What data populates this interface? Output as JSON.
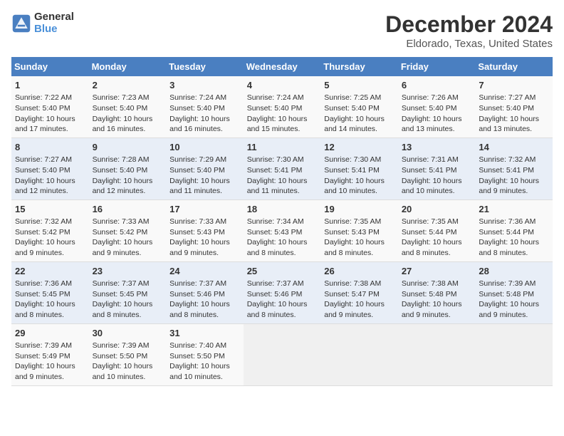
{
  "logo": {
    "line1": "General",
    "line2": "Blue"
  },
  "title": "December 2024",
  "subtitle": "Eldorado, Texas, United States",
  "days_of_week": [
    "Sunday",
    "Monday",
    "Tuesday",
    "Wednesday",
    "Thursday",
    "Friday",
    "Saturday"
  ],
  "weeks": [
    [
      {
        "day": "1",
        "info": "Sunrise: 7:22 AM\nSunset: 5:40 PM\nDaylight: 10 hours\nand 17 minutes."
      },
      {
        "day": "2",
        "info": "Sunrise: 7:23 AM\nSunset: 5:40 PM\nDaylight: 10 hours\nand 16 minutes."
      },
      {
        "day": "3",
        "info": "Sunrise: 7:24 AM\nSunset: 5:40 PM\nDaylight: 10 hours\nand 16 minutes."
      },
      {
        "day": "4",
        "info": "Sunrise: 7:24 AM\nSunset: 5:40 PM\nDaylight: 10 hours\nand 15 minutes."
      },
      {
        "day": "5",
        "info": "Sunrise: 7:25 AM\nSunset: 5:40 PM\nDaylight: 10 hours\nand 14 minutes."
      },
      {
        "day": "6",
        "info": "Sunrise: 7:26 AM\nSunset: 5:40 PM\nDaylight: 10 hours\nand 13 minutes."
      },
      {
        "day": "7",
        "info": "Sunrise: 7:27 AM\nSunset: 5:40 PM\nDaylight: 10 hours\nand 13 minutes."
      }
    ],
    [
      {
        "day": "8",
        "info": "Sunrise: 7:27 AM\nSunset: 5:40 PM\nDaylight: 10 hours\nand 12 minutes."
      },
      {
        "day": "9",
        "info": "Sunrise: 7:28 AM\nSunset: 5:40 PM\nDaylight: 10 hours\nand 12 minutes."
      },
      {
        "day": "10",
        "info": "Sunrise: 7:29 AM\nSunset: 5:40 PM\nDaylight: 10 hours\nand 11 minutes."
      },
      {
        "day": "11",
        "info": "Sunrise: 7:30 AM\nSunset: 5:41 PM\nDaylight: 10 hours\nand 11 minutes."
      },
      {
        "day": "12",
        "info": "Sunrise: 7:30 AM\nSunset: 5:41 PM\nDaylight: 10 hours\nand 10 minutes."
      },
      {
        "day": "13",
        "info": "Sunrise: 7:31 AM\nSunset: 5:41 PM\nDaylight: 10 hours\nand 10 minutes."
      },
      {
        "day": "14",
        "info": "Sunrise: 7:32 AM\nSunset: 5:41 PM\nDaylight: 10 hours\nand 9 minutes."
      }
    ],
    [
      {
        "day": "15",
        "info": "Sunrise: 7:32 AM\nSunset: 5:42 PM\nDaylight: 10 hours\nand 9 minutes."
      },
      {
        "day": "16",
        "info": "Sunrise: 7:33 AM\nSunset: 5:42 PM\nDaylight: 10 hours\nand 9 minutes."
      },
      {
        "day": "17",
        "info": "Sunrise: 7:33 AM\nSunset: 5:43 PM\nDaylight: 10 hours\nand 9 minutes."
      },
      {
        "day": "18",
        "info": "Sunrise: 7:34 AM\nSunset: 5:43 PM\nDaylight: 10 hours\nand 8 minutes."
      },
      {
        "day": "19",
        "info": "Sunrise: 7:35 AM\nSunset: 5:43 PM\nDaylight: 10 hours\nand 8 minutes."
      },
      {
        "day": "20",
        "info": "Sunrise: 7:35 AM\nSunset: 5:44 PM\nDaylight: 10 hours\nand 8 minutes."
      },
      {
        "day": "21",
        "info": "Sunrise: 7:36 AM\nSunset: 5:44 PM\nDaylight: 10 hours\nand 8 minutes."
      }
    ],
    [
      {
        "day": "22",
        "info": "Sunrise: 7:36 AM\nSunset: 5:45 PM\nDaylight: 10 hours\nand 8 minutes."
      },
      {
        "day": "23",
        "info": "Sunrise: 7:37 AM\nSunset: 5:45 PM\nDaylight: 10 hours\nand 8 minutes."
      },
      {
        "day": "24",
        "info": "Sunrise: 7:37 AM\nSunset: 5:46 PM\nDaylight: 10 hours\nand 8 minutes."
      },
      {
        "day": "25",
        "info": "Sunrise: 7:37 AM\nSunset: 5:46 PM\nDaylight: 10 hours\nand 8 minutes."
      },
      {
        "day": "26",
        "info": "Sunrise: 7:38 AM\nSunset: 5:47 PM\nDaylight: 10 hours\nand 9 minutes."
      },
      {
        "day": "27",
        "info": "Sunrise: 7:38 AM\nSunset: 5:48 PM\nDaylight: 10 hours\nand 9 minutes."
      },
      {
        "day": "28",
        "info": "Sunrise: 7:39 AM\nSunset: 5:48 PM\nDaylight: 10 hours\nand 9 minutes."
      }
    ],
    [
      {
        "day": "29",
        "info": "Sunrise: 7:39 AM\nSunset: 5:49 PM\nDaylight: 10 hours\nand 9 minutes."
      },
      {
        "day": "30",
        "info": "Sunrise: 7:39 AM\nSunset: 5:50 PM\nDaylight: 10 hours\nand 10 minutes."
      },
      {
        "day": "31",
        "info": "Sunrise: 7:40 AM\nSunset: 5:50 PM\nDaylight: 10 hours\nand 10 minutes."
      },
      null,
      null,
      null,
      null
    ]
  ]
}
